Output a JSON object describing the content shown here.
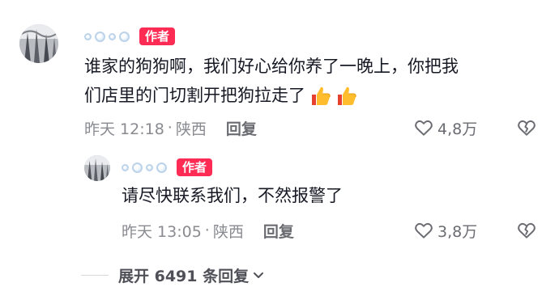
{
  "comments": [
    {
      "username_icon": "bubble-emoji",
      "badge": "作者",
      "text": "谁家的狗狗啊，我们好心给你养了一晚上，你把我",
      "text_line2": "们店里的门切割开把狗拉走了",
      "emoji": [
        "thumbs-up-icon",
        "thumbs-up-icon"
      ],
      "time": "昨天 12:18",
      "location": "陕西",
      "reply_label": "回复",
      "likes": "4,8万"
    },
    {
      "username_icon": "bubble-emoji",
      "badge": "作者",
      "text": "请尽快联系我们，不然报警了",
      "time": "昨天 13:05",
      "location": "陕西",
      "reply_label": "回复",
      "likes": "3,8万"
    }
  ],
  "expand_label": "展开 6491 条回复",
  "colors": {
    "badge": "#fe2c55",
    "meta": "#8a8b91",
    "text": "#161823"
  }
}
